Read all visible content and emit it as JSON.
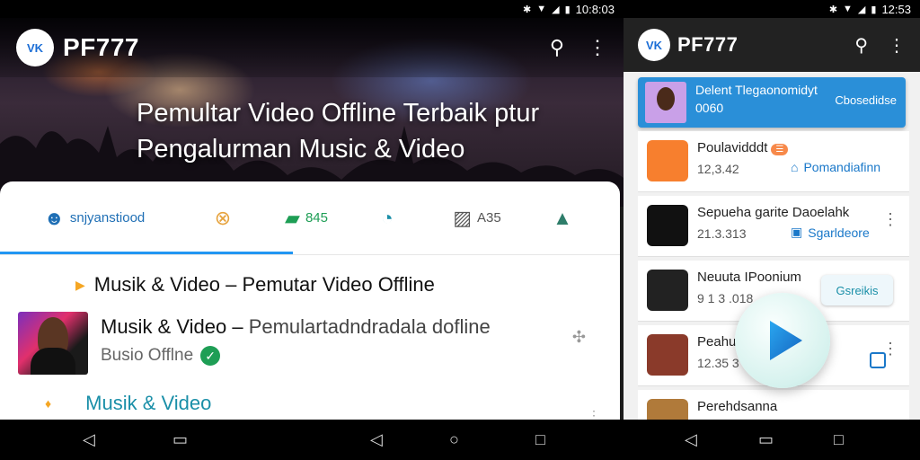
{
  "status_left": {
    "time": "10:8:03"
  },
  "status_right": {
    "time": "12:53"
  },
  "left": {
    "appbar": {
      "brand": "PF777",
      "logo_text": "VK"
    },
    "hero_title_line1": "Pemultar Video Offline Terbaik ptur",
    "hero_title_line2": "Pengalurman Music & Video",
    "tabs": [
      {
        "icon": "profile-icon",
        "label": "snjyanstiood"
      },
      {
        "icon": "close-circle-icon",
        "label": ""
      },
      {
        "icon": "trend-icon",
        "label": "845"
      },
      {
        "icon": "refresh-icon",
        "label": ""
      },
      {
        "icon": "image-icon",
        "label": "A35"
      },
      {
        "icon": "text-icon",
        "label": ""
      }
    ],
    "row1": "Musik & Video – Pemutar Video Offline",
    "item": {
      "title_main": "Musik & Video – ",
      "title_dim": "Pemulartadndradala dofline",
      "subtitle": "Busio Offlne"
    },
    "row3": "Musik & Video"
  },
  "right": {
    "appbar": {
      "brand": "PF777",
      "logo_text": "VK"
    },
    "banner": {
      "line1": "Delent Tlegaonomidyt",
      "line2": "0060",
      "action": "Cbosedidse"
    },
    "cards": [
      {
        "title": "Poulavidddt",
        "badge": "☰",
        "meta": "12,3.42",
        "action": "Pomandiafinn"
      },
      {
        "title": "Sepueha garite  Daoelahk",
        "meta": "21.3.313",
        "action": "Sgarldeore"
      },
      {
        "title": "Neuuta IPoonium",
        "meta": "9 1 3 .018",
        "action": "Gsreikis"
      },
      {
        "title": "Peahu",
        "meta": "12.35 3"
      },
      {
        "title": "Perehdsanna",
        "meta": ""
      }
    ]
  },
  "colors": {
    "accent": "#2196f3",
    "banner": "#2a8fd8",
    "verified": "#1e9e55",
    "teal": "#1a8fa8"
  }
}
